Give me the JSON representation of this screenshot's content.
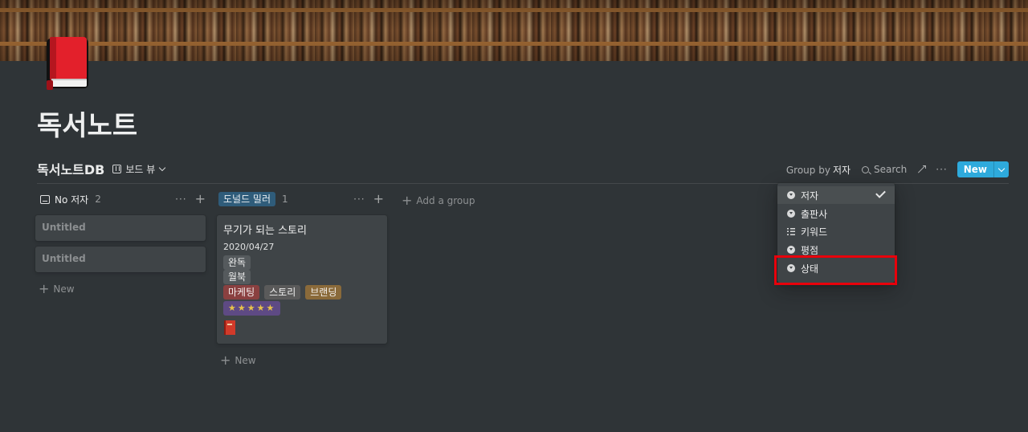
{
  "page": {
    "title": "독서노트"
  },
  "database": {
    "title": "독서노트DB",
    "view_label": "보드 뷰"
  },
  "toolbar": {
    "group_by_prefix": "Group by",
    "group_by_value": "저자",
    "search_label": "Search",
    "more_label": "···",
    "new_label": "New"
  },
  "columns": [
    {
      "label": "No 저자",
      "count": "2",
      "cards": [
        {
          "title": "Untitled"
        },
        {
          "title": "Untitled"
        }
      ],
      "new_label": "New"
    },
    {
      "label": "도널드 밀러",
      "count": "1",
      "tag_color": "#2f5c7a",
      "cards": [
        {
          "title": "무기가 되는 스토리",
          "date": "2020/04/27",
          "status": "완독",
          "status2": "월북",
          "keywords": [
            "마케팅",
            "스토리",
            "브랜딩"
          ],
          "keyword_colors": [
            "#8a4040",
            "#5a5a5a",
            "#8a6a3a"
          ],
          "rating": "★★★★★",
          "rating_color": "#5e4a84"
        }
      ],
      "new_label": "New"
    }
  ],
  "add_group_label": "Add a group",
  "group_menu": {
    "items": [
      {
        "label": "저자",
        "icon": "select",
        "selected": true
      },
      {
        "label": "출판사",
        "icon": "select",
        "selected": false
      },
      {
        "label": "키워드",
        "icon": "multi-select",
        "selected": false
      },
      {
        "label": "평점",
        "icon": "select",
        "selected": false
      },
      {
        "label": "상태",
        "icon": "select",
        "selected": false,
        "highlighted": true
      }
    ]
  },
  "colors": {
    "background": "#2f3437",
    "card": "#3f4447",
    "accent": "#2eaadc",
    "highlight_box": "#e8000b",
    "book_icon": "#e3202b"
  }
}
